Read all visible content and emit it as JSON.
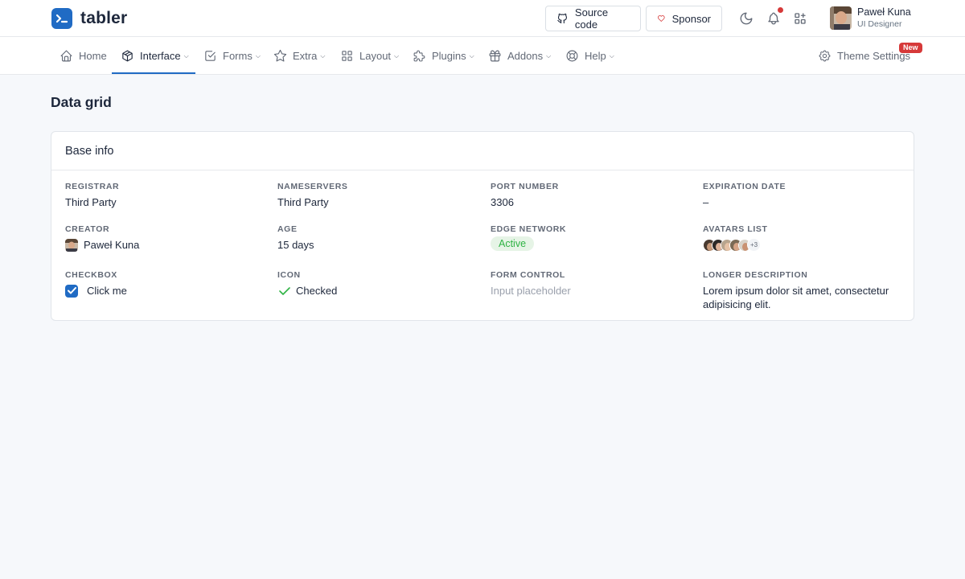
{
  "header": {
    "brand_name": "tabler",
    "source_code_label": "Source code",
    "sponsor_label": "Sponsor",
    "user": {
      "name": "Paweł Kuna",
      "role": "UI Designer"
    },
    "colors": {
      "brand": "#206bc4",
      "notification_dot": "#d63939",
      "sponsor_heart": "#d63939"
    }
  },
  "nav": {
    "items": [
      {
        "label": "Home",
        "icon": "home-icon"
      },
      {
        "label": "Interface",
        "icon": "package-icon",
        "active": true
      },
      {
        "label": "Forms",
        "icon": "checkbox-icon"
      },
      {
        "label": "Extra",
        "icon": "star-icon"
      },
      {
        "label": "Layout",
        "icon": "layout-grid-icon"
      },
      {
        "label": "Plugins",
        "icon": "puzzle-icon"
      },
      {
        "label": "Addons",
        "icon": "gift-icon"
      },
      {
        "label": "Help",
        "icon": "lifebuoy-icon"
      }
    ],
    "theme_settings": {
      "label": "Theme Settings",
      "icon": "gear-icon",
      "badge": "New"
    }
  },
  "page": {
    "title": "Data grid",
    "card_title": "Base info"
  },
  "grid": {
    "registrar": {
      "title": "Registrar",
      "value": "Third Party"
    },
    "nameservers": {
      "title": "Nameservers",
      "value": "Third Party"
    },
    "port": {
      "title": "Port number",
      "value": "3306"
    },
    "expiration": {
      "title": "Expiration date",
      "value": "–"
    },
    "creator": {
      "title": "Creator",
      "value": "Paweł Kuna"
    },
    "age": {
      "title": "Age",
      "value": "15 days"
    },
    "edge": {
      "title": "Edge network",
      "value": "Active"
    },
    "avatars": {
      "title": "Avatars list",
      "more": "+3"
    },
    "checkbox": {
      "title": "Checkbox",
      "value": "Click me",
      "checked": true
    },
    "icon": {
      "title": "Icon",
      "value": "Checked"
    },
    "form_control": {
      "title": "Form control",
      "placeholder": "Input placeholder"
    },
    "description": {
      "title": "Longer description",
      "value": "Lorem ipsum dolor sit amet, consectetur adipisicing elit."
    }
  }
}
